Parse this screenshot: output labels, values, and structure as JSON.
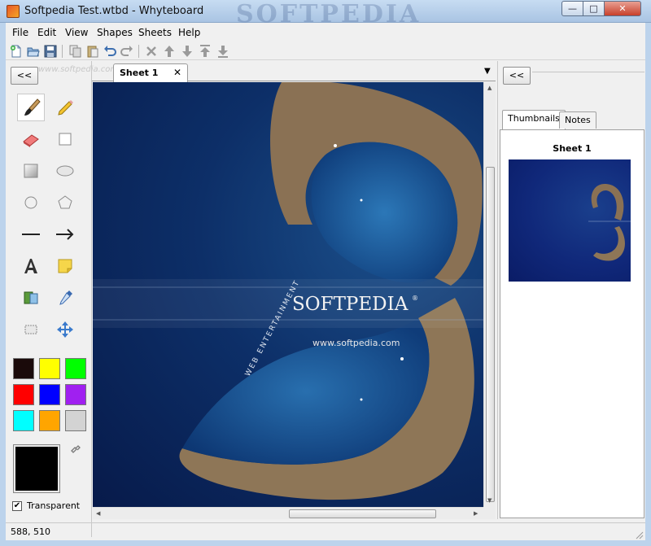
{
  "window": {
    "title": "Softpedia Test.wtbd - Whyteboard",
    "watermark": "SOFTPEDIA",
    "min_glyph": "—",
    "max_glyph": "□",
    "close_glyph": "✕"
  },
  "menu": [
    "File",
    "Edit",
    "View",
    "Shapes",
    "Sheets",
    "Help"
  ],
  "toolbar": {
    "icons": [
      "new-icon",
      "open-icon",
      "save-icon",
      "copy-icon",
      "paste-icon",
      "undo-icon",
      "redo-icon",
      "delete-icon",
      "move-up-icon",
      "move-down-icon",
      "move-to-top-icon",
      "move-to-bottom-icon"
    ]
  },
  "left_panel": {
    "collapse_label": "<<",
    "watermark": "www.softpedia.com",
    "tools": [
      "pen",
      "highlighter",
      "eraser",
      "rectangle",
      "rounded-rectangle",
      "ellipse",
      "circle",
      "polygon",
      "line",
      "arrow",
      "text",
      "note",
      "media",
      "eyedropper",
      "select",
      "pan"
    ],
    "swatches": [
      "#1a0a0a",
      "#ffff00",
      "#00ff00",
      "#ff0000",
      "#0000ff",
      "#a020f0",
      "#00ffff",
      "#ffa500",
      "#d3d3d3"
    ],
    "current_color": "#000000",
    "transparent_label": "Transparent",
    "transparent_checked": true
  },
  "tabs": [
    {
      "label": "Sheet 1",
      "close_glyph": "✕"
    }
  ],
  "canvas": {
    "logo_text": "SOFTPEDIA",
    "logo_trademark": "®",
    "url_text": "www.softpedia.com",
    "arc_text": "WEB ENTERTAINMENT"
  },
  "right_panel": {
    "collapse_label": "<<",
    "tabs": [
      "Thumbnails",
      "Notes"
    ],
    "active_tab": "Thumbnails",
    "thumbnail_title": "Sheet 1"
  },
  "status": {
    "coords": "588, 510"
  }
}
